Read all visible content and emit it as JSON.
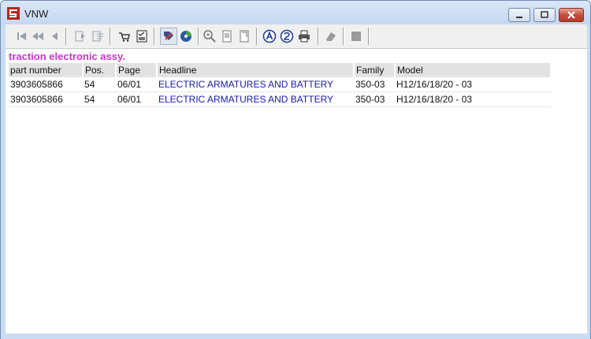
{
  "window": {
    "title": "VNW"
  },
  "toolbar": {
    "icons": [
      "first-icon",
      "rewind-icon",
      "prev-icon",
      "next-doc-icon",
      "forward-doc-icon",
      "cart-icon",
      "checklist-icon",
      "tag-icon",
      "chart-icon",
      "zoom-in-icon",
      "page-icon",
      "page-fit-icon",
      "font-a-icon",
      "font-2-icon",
      "print-icon",
      "eraser-icon",
      "stop-icon"
    ]
  },
  "content": {
    "section_title": "traction electronic assy.",
    "table": {
      "headers": [
        "part number",
        "Pos.",
        "Page",
        "Headline",
        "Family",
        "Model"
      ],
      "rows": [
        [
          "3903605866",
          "54",
          "06/01",
          "ELECTRIC ARMATURES AND BATTERY",
          "350-03",
          "H12/16/18/20 - 03"
        ],
        [
          "3903605866",
          "54",
          "06/01",
          "ELECTRIC ARMATURES AND BATTERY",
          "350-03",
          "H12/16/18/20 - 03"
        ]
      ]
    }
  }
}
